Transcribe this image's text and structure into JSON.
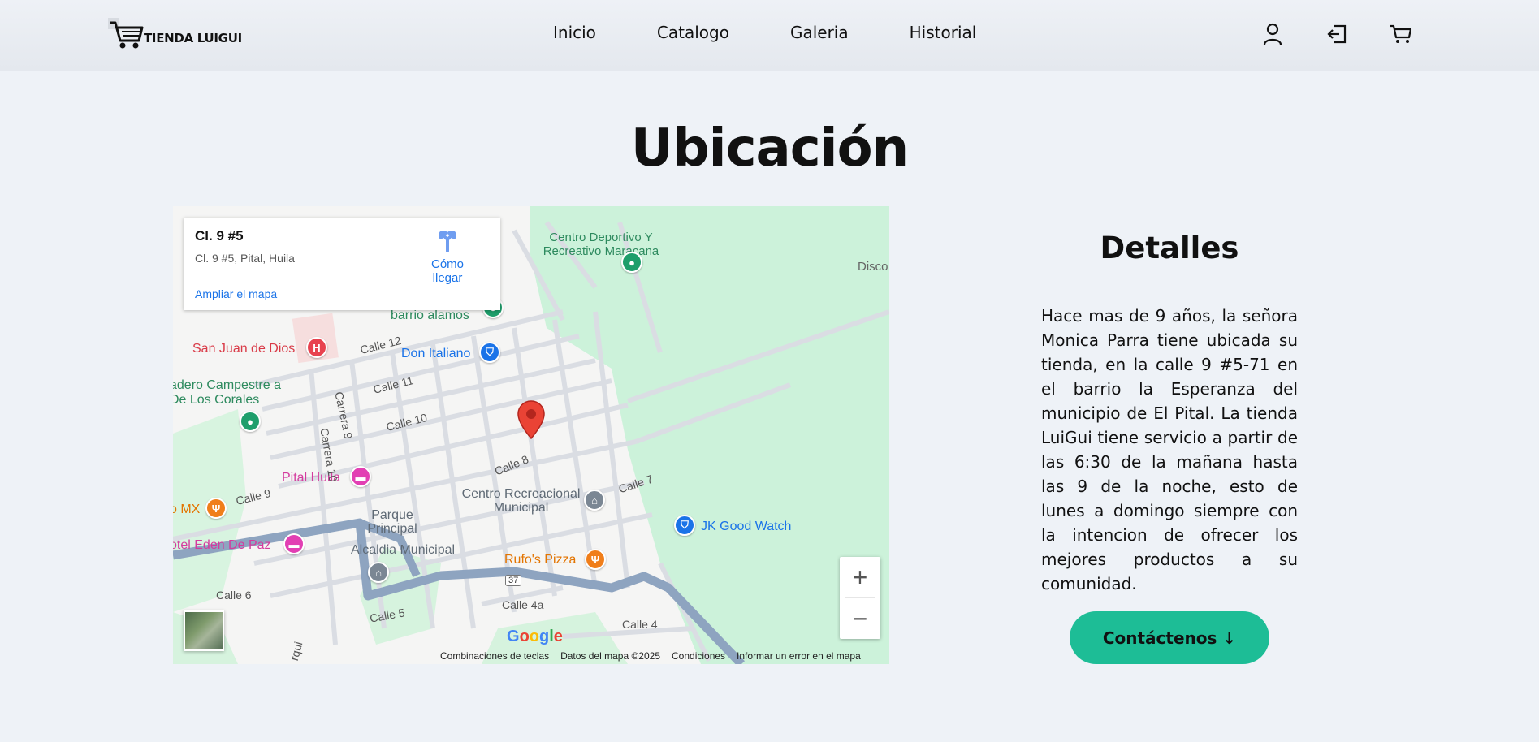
{
  "header": {
    "logo_text": "TIENDA LUIGUI",
    "nav": [
      "Inicio",
      "Catalogo",
      "Galeria",
      "Historial"
    ],
    "icons": [
      "user-icon",
      "logout-icon",
      "cart-icon"
    ]
  },
  "page": {
    "title": "Ubicación"
  },
  "map": {
    "card": {
      "title": "Cl. 9 #5",
      "address": "Cl. 9 #5, Pital, Huila",
      "directions_label": "Cómo llegar",
      "expand_label": "Ampliar el mapa"
    },
    "labels": {
      "centro_deportivo": "Centro Deportivo Y Recreativo Maracana",
      "disco": "Disco",
      "barrio_alamos": "barrio alamos",
      "san_juan": "San Juan de Dios",
      "don_italiano": "Don Italiano",
      "campestre": "adero Campestre a De Los Corales",
      "pital_huila": "Pital Huila",
      "centro_recreacional": "Centro Recreacional Municipal",
      "jk_good_watch": "JK Good Watch",
      "mx": "o MX",
      "parque": "Parque Principal",
      "hotel": "otel Eden De Paz",
      "alcaldia": "Alcaldia Municipal",
      "rufos": "Rufo's Pizza",
      "calle_12": "Calle 12",
      "calle_11": "Calle 11",
      "calle_10": "Calle 10",
      "calle_9": "Calle 9",
      "calle_8": "Calle 8",
      "calle_7": "Calle 7",
      "calle_6": "Calle 6",
      "calle_5": "Calle 5",
      "calle_4a": "Calle 4a",
      "calle_4": "Calle 4",
      "carrera_9": "Carrera 9",
      "carrera_10": "Carrera 10",
      "route_37": "37",
      "bottom_left": "rqui"
    },
    "zoom_in": "+",
    "zoom_out": "−",
    "google": "Google",
    "attribution": [
      "Combinaciones de teclas",
      "Datos del mapa ©2025",
      "Condiciones",
      "Informar un error en el mapa"
    ]
  },
  "details": {
    "title": "Detalles",
    "text": "Hace mas de 9 años, la señora Monica Parra tiene ubicada su tienda, en la calle 9 #5-71 en el barrio la Esperanza del municipio de El Pital. La tienda LuiGui tiene servicio a partir de las 6:30 de la mañana hasta las 9 de la noche, esto de lunes a domingo siempre con la intencion de ofrecer los mejores productos a su comunidad.",
    "contact_button": "Contáctenos ↓"
  },
  "colors": {
    "background": "#eef2f7",
    "accent": "#1dbd96",
    "map_link": "#1a73e8",
    "marker": "#ea4335"
  }
}
